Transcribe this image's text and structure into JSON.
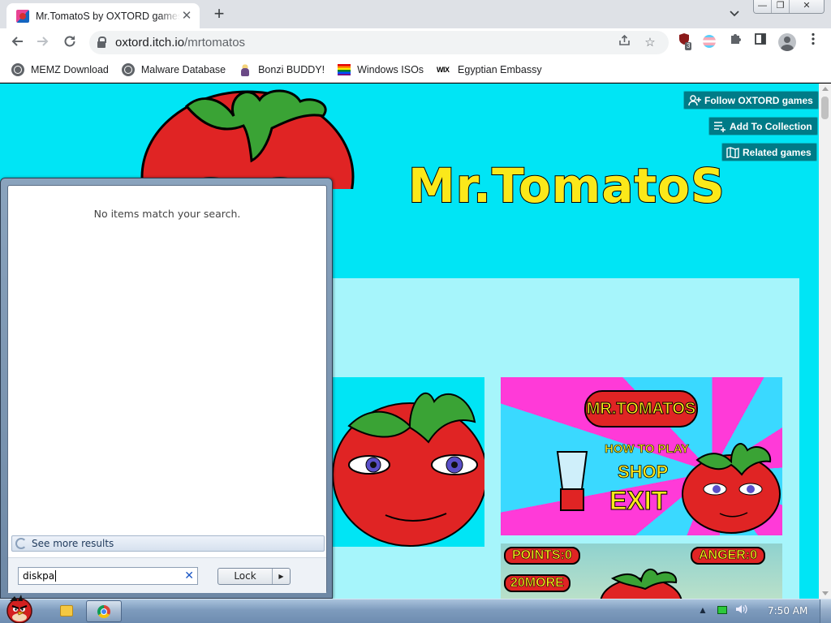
{
  "browser": {
    "tab": {
      "title": "Mr.TomatoS by OXTORD games",
      "close_symbol": "✕"
    },
    "new_tab_symbol": "+",
    "window_controls": {
      "minimize": "—",
      "maximize": "❐",
      "close": "✕"
    },
    "address": {
      "host": "oxtord.itch.io",
      "path": "/mrtomatos"
    },
    "extension_badge": "3",
    "bookmarks": [
      {
        "label": "MEMZ Download",
        "icon": "globe-icon"
      },
      {
        "label": "Malware Database",
        "icon": "globe-icon"
      },
      {
        "label": "Bonzi BUDDY!",
        "icon": "bonzi-icon"
      },
      {
        "label": "Windows ISOs",
        "icon": "rainbow-flag-icon"
      },
      {
        "label": "Egyptian Embassy",
        "icon": "wix-icon"
      }
    ]
  },
  "itch_page": {
    "background_color": "#00e5f5",
    "buttons": {
      "follow": "Follow OXTORD games",
      "collection": "Add To Collection",
      "related": "Related games"
    },
    "game_title": "Mr.TomatoS",
    "screenshot_menu": {
      "logo": "MR.TOMATOS",
      "how_to_play": "HOW TO PLAY",
      "shop": "SHOP",
      "exit": "EXIT"
    },
    "screenshot_hud": {
      "points": "POINTS:0",
      "anger": "ANGER:0",
      "more": "20MORE"
    }
  },
  "start_search": {
    "no_results": "No items match your search.",
    "see_more": "See more results",
    "query": "diskpa",
    "clear_symbol": "✕",
    "lock_button": "Lock",
    "lock_arrow": "▶"
  },
  "taskbar": {
    "clock": "7:50 AM"
  },
  "colors": {
    "itch_button": "#007b87",
    "title_yellow": "#fbe81a",
    "tomato_red": "#e02424",
    "leaf_green": "#3aa335"
  }
}
